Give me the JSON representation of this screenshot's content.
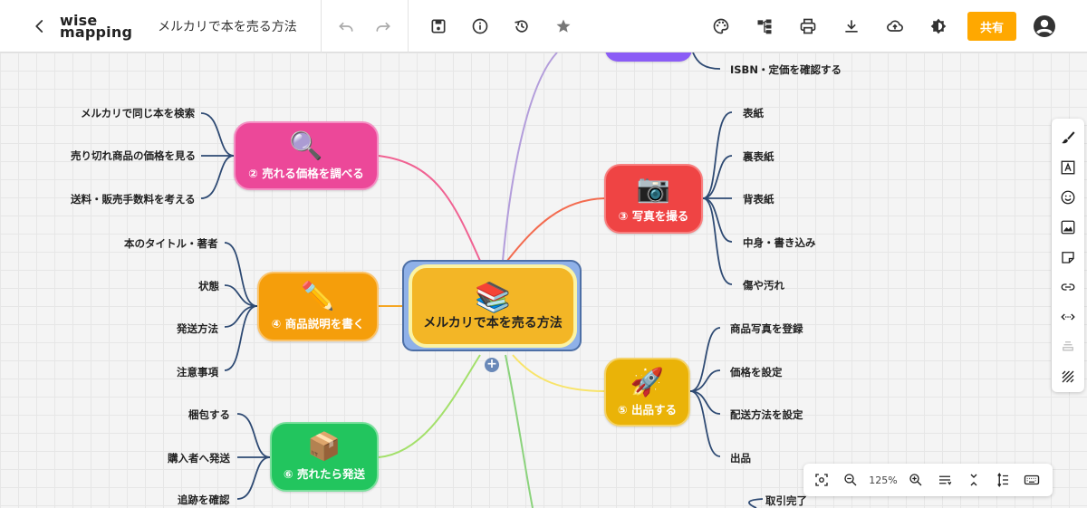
{
  "header": {
    "logo_line1": "wise",
    "logo_line2": "mapping",
    "map_title": "メルカリで本を売る方法",
    "share_label": "共有"
  },
  "icons": {
    "back": "back-arrow-icon",
    "undo": "undo-icon",
    "redo": "redo-icon",
    "save": "save-icon",
    "info": "info-icon",
    "history": "history-icon",
    "star": "star-icon",
    "palette": "palette-icon",
    "layout": "layout-tree-icon",
    "print": "print-icon",
    "download": "download-icon",
    "publish": "cloud-upload-icon",
    "theme": "theme-toggle-icon",
    "account": "account-icon"
  },
  "colors": {
    "accent": "#ffa800",
    "node2": "#ec4899",
    "node3": "#ef4444",
    "node4": "#f59e0b",
    "node5": "#eab308",
    "node6": "#22c55e",
    "central": "#f3b626"
  },
  "map": {
    "central": {
      "emoji": "📚",
      "label": "メルカリで本を売る方法"
    },
    "nodes": [
      {
        "id": "price",
        "emoji": "🔍",
        "label": "② 売れる価格を調べる",
        "leaves": [
          "メルカリで同じ本を検索",
          "売り切れ商品の価格を見る",
          "送料・販売手数料を考える"
        ]
      },
      {
        "id": "photo",
        "emoji": "📷",
        "label": "③ 写真を撮る",
        "leaves": [
          "表紙",
          "裏表紙",
          "背表紙",
          "中身・書き込み",
          "傷や汚れ"
        ]
      },
      {
        "id": "desc",
        "emoji": "✏️",
        "label": "④ 商品説明を書く",
        "leaves": [
          "本のタイトル・著者",
          "状態",
          "発送方法",
          "注意事項"
        ]
      },
      {
        "id": "list",
        "emoji": "🚀",
        "label": "⑤ 出品する",
        "leaves": [
          "商品写真を登録",
          "価格を設定",
          "配送方法を設定",
          "出品"
        ]
      },
      {
        "id": "ship",
        "emoji": "📦",
        "label": "⑥ 売れたら発送",
        "leaves": [
          "梱包する",
          "購入者へ発送",
          "追跡を確認"
        ]
      }
    ],
    "top_leaf": "ISBN・定価を確認する",
    "bottom_leaf": "取引完了"
  },
  "zoom": {
    "level": "125%"
  },
  "side_panel": [
    "brush-icon",
    "text-style-icon",
    "emoji-icon",
    "image-icon",
    "note-icon",
    "link-icon",
    "relationship-icon",
    "shape-icon",
    "pattern-icon"
  ]
}
